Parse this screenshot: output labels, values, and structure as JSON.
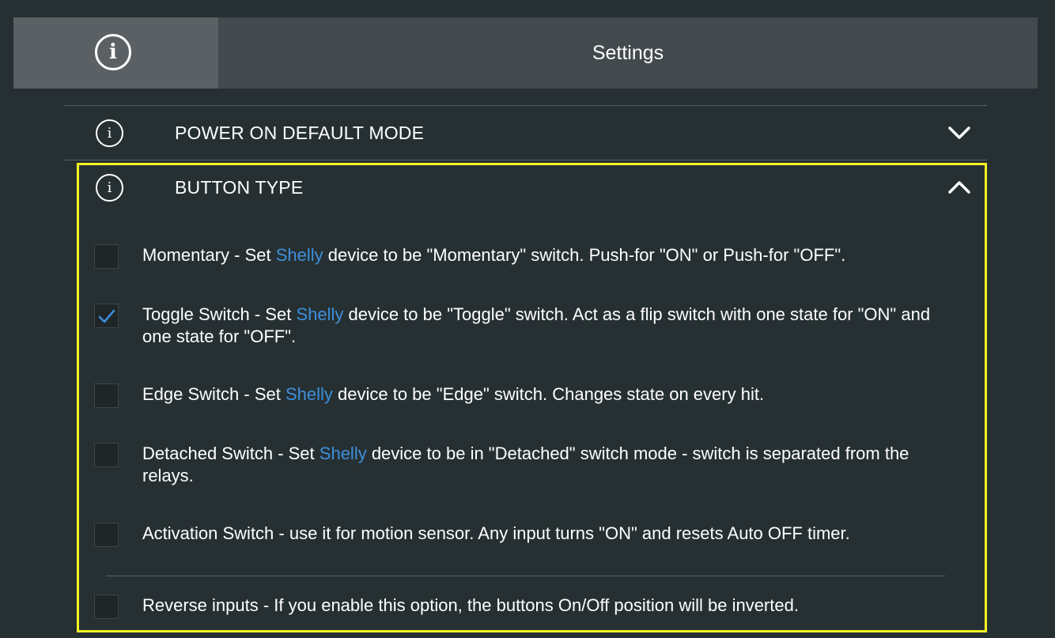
{
  "header": {
    "title": "Settings",
    "icon": "info-icon"
  },
  "sections": [
    {
      "label": "POWER ON DEFAULT MODE",
      "icon": "info-icon",
      "expanded": false,
      "chevron": "chevron-down-icon"
    },
    {
      "label": "BUTTON TYPE",
      "icon": "info-icon",
      "expanded": true,
      "chevron": "chevron-up-icon"
    }
  ],
  "button_type_options": [
    {
      "checked": false,
      "text_before": "Momentary - Set ",
      "brand": "Shelly",
      "text_after": " device to be \"Momentary\" switch. Push-for \"ON\" or Push-for \"OFF\"."
    },
    {
      "checked": true,
      "text_before": "Toggle Switch - Set ",
      "brand": "Shelly",
      "text_after": " device to be \"Toggle\" switch. Act as a flip switch with one state for \"ON\" and one state for \"OFF\"."
    },
    {
      "checked": false,
      "text_before": "Edge Switch - Set ",
      "brand": "Shelly",
      "text_after": " device to be \"Edge\" switch. Changes state on every hit."
    },
    {
      "checked": false,
      "text_before": "Detached Switch - Set ",
      "brand": "Shelly",
      "text_after": " device to be in \"Detached\" switch mode - switch is separated from the relays."
    },
    {
      "checked": false,
      "text_before": "Activation Switch - use it for motion sensor. Any input turns \"ON\" and resets Auto OFF timer.",
      "brand": "",
      "text_after": ""
    }
  ],
  "reverse_inputs": {
    "checked": false,
    "text": "Reverse inputs - If you enable this option, the buttons On/Off position will be inverted."
  },
  "colors": {
    "background": "#263033",
    "header": "#434a4d",
    "header_icon_box": "#5a6063",
    "brand_link": "#3d8fdc",
    "highlight": "#f5f522",
    "checkmark": "#3d8fdc"
  }
}
